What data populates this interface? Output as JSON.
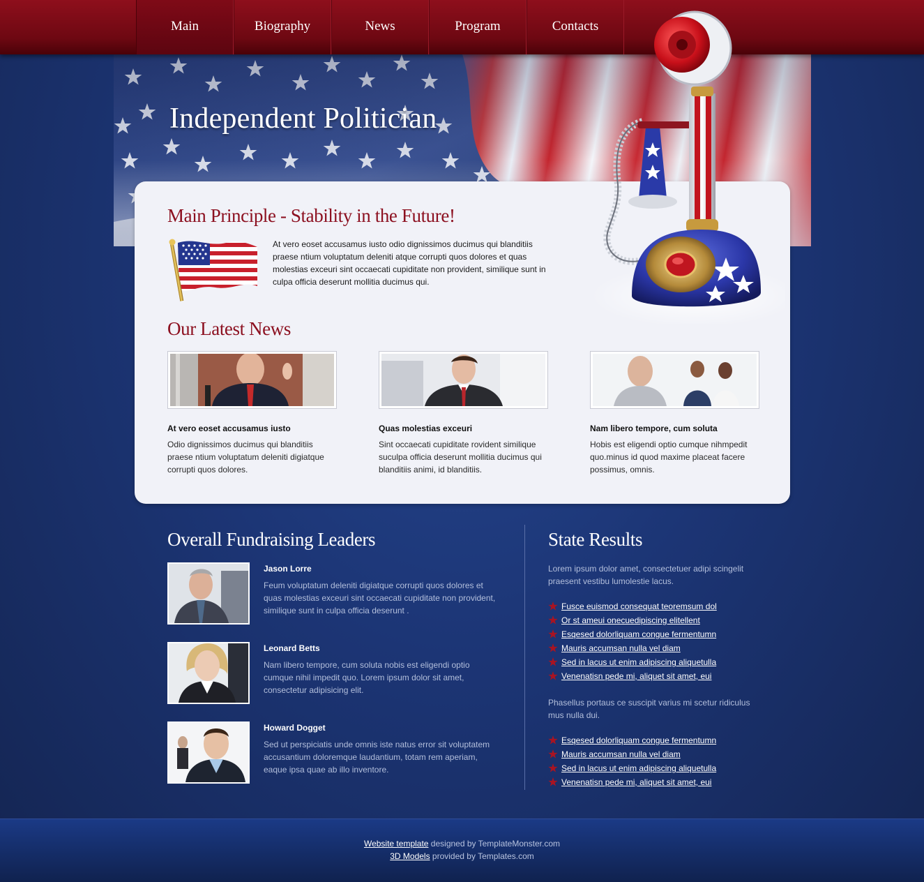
{
  "nav": {
    "items": [
      {
        "label": "Main"
      },
      {
        "label": "Biography"
      },
      {
        "label": "News"
      },
      {
        "label": "Program"
      },
      {
        "label": "Contacts"
      }
    ]
  },
  "header": {
    "title": "Independent Politician"
  },
  "principle": {
    "title": "Main Principle - Stability in the Future!",
    "text": "At vero eoset accusamus iusto odio dignissimos ducimus qui blanditiis praese ntium voluptatum deleniti atque corrupti quos dolores et quas molestias exceuri sint occaecati cupiditate non provident, similique sunt in culpa officia deserunt mollitia ducimus qui."
  },
  "news": {
    "title": "Our Latest News",
    "items": [
      {
        "heading": "At vero eoset accusamus iusto",
        "body": "Odio dignissimos ducimus qui blanditiis praese ntium voluptatum deleniti digiatque corrupti quos dolores."
      },
      {
        "heading": "Quas molestias exceuri",
        "body": "Sint occaecati cupiditate rovident similique suculpa officia deserunt mollitia ducimus qui blanditiis animi, id blanditiis."
      },
      {
        "heading": "Nam libero tempore, cum soluta",
        "body": "Hobis est eligendi optio cumque nihmpedit quo.minus id quod maxime placeat facere possimus, omnis."
      }
    ]
  },
  "leaders": {
    "title": "Overall Fundraising Leaders",
    "items": [
      {
        "name": "Jason Lorre",
        "text": "Feum voluptatum deleniti digiatque corrupti quos dolores et quas molestias exceuri sint occaecati cupiditate non provident, similique sunt in culpa officia deserunt ."
      },
      {
        "name": "Leonard Betts",
        "text": "Nam libero tempore, cum soluta nobis est eligendi optio cumque nihil impedit quo. Lorem ipsum dolor sit amet, consectetur adipisicing elit."
      },
      {
        "name": "Howard Dogget",
        "text": "Sed ut perspiciatis unde omnis iste natus error sit voluptatem accusantium doloremque laudantium, totam rem aperiam, eaque ipsa quae ab illo inventore."
      }
    ]
  },
  "state": {
    "title": "State Results",
    "intro": "Lorem ipsum dolor amet, consectetuer adipi scingelit praesent vestibu lumolestie lacus.",
    "links1": [
      "Fusce euismod consequat teoremsum dol",
      "Or st ameui onecuedipiscing elitellent",
      "Esqesed dolorliquam congue fermentumn",
      "Mauris accumsan nulla vel diam",
      "Sed in lacus ut enim adipiscing aliquetulla",
      "Venenatisn pede mi, aliquet sit amet, eui"
    ],
    "middle": "Phasellus portaus ce suscipit varius mi scetur ridiculus mus nulla dui.",
    "links2": [
      "Esqesed dolorliquam congue fermentumn",
      "Mauris accumsan nulla vel diam",
      "Sed in lacus ut enim adipiscing aliquetulla",
      "Venenatisn pede mi, aliquet sit amet, eui"
    ]
  },
  "footer": {
    "line1_link": "Website template",
    "line1_text": " designed by TemplateMonster.com",
    "line2_link": "3D Models",
    "line2_text": " provided by Templates.com"
  },
  "colors": {
    "nav_red": "#8e0f1c",
    "heading_red": "#8c1020",
    "page_blue": "#1c3575",
    "panel_bg": "#f1f2f8",
    "muted_text": "#b3bfdc"
  },
  "icons": [
    "flag-icon",
    "star-bullet-icon",
    "candlestick-phone-illustration"
  ]
}
